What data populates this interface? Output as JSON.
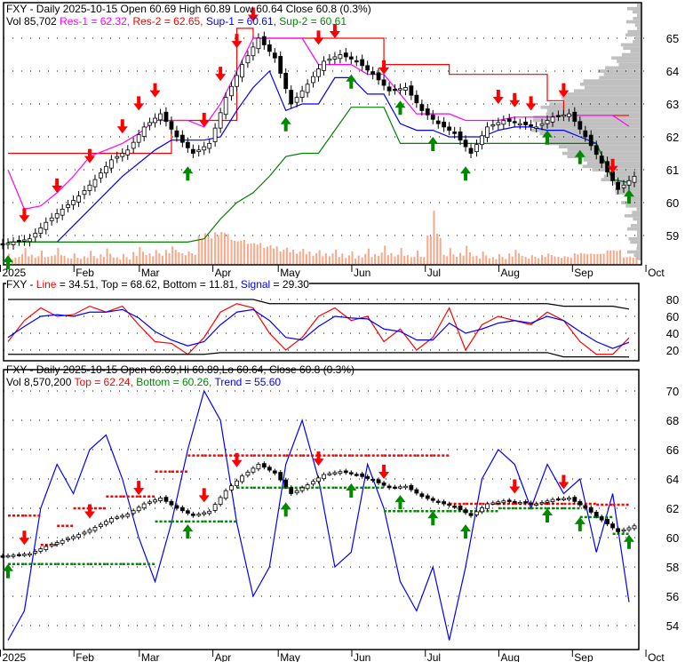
{
  "panel1": {
    "line1": "FXY - Daily 2025-10-15 Open 60.69  High 60.89  Low 60.64  Close 60.8 (0.3%)",
    "vol": "Vol 85,702",
    "res1": "Res-1 = 62.32,",
    "res2": "Res-2 = 62.65,",
    "sup1": "Sup-1 = 60.61,",
    "sup2": "Sup-2 = 60.61"
  },
  "panel2": {
    "prefix": "FXY - ",
    "line": "Line",
    "mid": " = 34.51, Top = 68.62, Bottom = 11.81, ",
    "signal": "Signal",
    "end": " = 29.30"
  },
  "panel3": {
    "line1": "FXY - Daily 2025-10-15 Open 60.69,Hi 60.89,Lo 60.64, Close 60.8 (0.3%)",
    "vol": "Vol 8,570,200",
    "top": "Top = 62.24,",
    "bottom": "Bottom = 60.26,",
    "trend": "Trend = 55.60"
  },
  "colors": {
    "res1": "#ff00ff",
    "res2": "#ff0000",
    "sup1": "#0000ff",
    "sup2": "#008000",
    "volume": "#f8a888",
    "profile": "#c0c0c0"
  },
  "chart_data": [
    {
      "type": "candlestick",
      "title": "FXY - Daily",
      "x_labels": [
        "2025",
        "Feb",
        "Mar",
        "Apr",
        "May",
        "Jun",
        "Jul",
        "Aug",
        "Sep",
        "Oct"
      ],
      "x_label_index": [
        0,
        4.5,
        8.5,
        13,
        17,
        21.5,
        26,
        30.5,
        35,
        39.5
      ],
      "y_ticks": [
        59,
        60,
        61,
        62,
        63,
        64,
        65
      ],
      "ylim": [
        58.2,
        66
      ],
      "close": [
        58.8,
        58.9,
        59.4,
        59.8,
        60.2,
        60.7,
        61.3,
        61.6,
        62.3,
        62.7,
        62.0,
        61.5,
        61.8,
        63.2,
        64.2,
        65.0,
        64.4,
        63.0,
        63.6,
        64.3,
        64.5,
        64.3,
        63.9,
        63.4,
        63.5,
        62.8,
        62.4,
        62.1,
        61.5,
        62.3,
        62.5,
        62.4,
        62.3,
        62.6,
        62.7,
        62.0,
        61.2,
        60.4,
        60.8
      ],
      "volume_rel": [
        0.2,
        0.3,
        0.25,
        0.3,
        0.2,
        0.25,
        0.3,
        0.2,
        0.35,
        0.3,
        0.4,
        0.3,
        0.8,
        0.9,
        0.7,
        0.6,
        0.5,
        0.4,
        0.35,
        0.3,
        0.3,
        0.25,
        0.3,
        0.35,
        0.3,
        0.25,
        1.0,
        0.3,
        0.35,
        0.25,
        0.2,
        0.3,
        0.2,
        0.25,
        0.2,
        0.3,
        0.3,
        0.4,
        0.2
      ],
      "res2": [
        61.5,
        61.5,
        61.5,
        61.5,
        61.5,
        61.5,
        61.5,
        61.5,
        61.5,
        61.5,
        62.5,
        62.5,
        62.5,
        62.5,
        65.3,
        65.0,
        65.0,
        65.0,
        65.0,
        65.0,
        65.0,
        65.0,
        65.0,
        64.2,
        64.2,
        64.2,
        64.2,
        63.9,
        63.9,
        63.9,
        63.9,
        63.9,
        63.9,
        63.1,
        62.65,
        62.65,
        62.65,
        62.65,
        62.65
      ],
      "res1": [
        61.0,
        59.8,
        59.9,
        60.3,
        60.8,
        61.4,
        61.6,
        61.8,
        62.1,
        62.5,
        62.5,
        62.5,
        62.3,
        63.0,
        64.0,
        65.0,
        65.0,
        65.0,
        65.0,
        64.2,
        64.2,
        64.2,
        63.9,
        63.9,
        63.3,
        62.7,
        62.7,
        62.7,
        62.5,
        62.5,
        62.5,
        62.6,
        62.6,
        62.6,
        62.65,
        62.65,
        62.65,
        62.65,
        62.32
      ],
      "sup1": [
        58.8,
        58.8,
        58.8,
        58.8,
        59.3,
        59.8,
        60.3,
        60.8,
        61.2,
        61.6,
        61.9,
        61.9,
        61.9,
        62.0,
        62.8,
        63.5,
        64.0,
        62.8,
        63.0,
        63.0,
        63.8,
        63.8,
        63.3,
        63.3,
        62.4,
        62.2,
        62.2,
        62.0,
        62.0,
        62.0,
        62.2,
        62.3,
        62.3,
        62.2,
        62.2,
        62.0,
        61.8,
        60.7,
        60.61
      ],
      "sup2": [
        58.8,
        58.8,
        58.8,
        58.8,
        58.8,
        58.8,
        58.8,
        58.8,
        58.8,
        58.8,
        58.8,
        58.8,
        58.9,
        59.5,
        60.0,
        60.3,
        60.8,
        61.4,
        61.5,
        61.5,
        62.2,
        62.9,
        62.9,
        62.9,
        61.8,
        61.8,
        61.8,
        61.8,
        61.8,
        61.8,
        61.8,
        61.8,
        61.8,
        61.8,
        61.8,
        61.8,
        61.8,
        60.7,
        60.61
      ],
      "sell_signals": [
        1,
        3,
        5,
        7,
        8,
        9,
        12,
        13,
        14,
        15,
        19,
        20,
        23,
        30,
        31,
        32,
        34,
        37
      ],
      "buy_signals": [
        0,
        11,
        17,
        21,
        24,
        26,
        28,
        33,
        35,
        38
      ]
    },
    {
      "type": "line",
      "title": "Oscillator",
      "y_ticks": [
        20,
        40,
        60,
        80
      ],
      "ylim": [
        5,
        95
      ],
      "series": [
        {
          "name": "Line",
          "color": "#ff0000",
          "values": [
            30,
            55,
            70,
            60,
            62,
            72,
            65,
            72,
            50,
            30,
            28,
            15,
            35,
            65,
            75,
            70,
            40,
            20,
            35,
            60,
            70,
            55,
            60,
            30,
            45,
            20,
            35,
            70,
            20,
            50,
            60,
            55,
            50,
            65,
            55,
            30,
            15,
            15,
            34.51
          ]
        },
        {
          "name": "Signal",
          "color": "#0000ff",
          "values": [
            35,
            48,
            60,
            62,
            60,
            65,
            65,
            68,
            58,
            42,
            32,
            25,
            30,
            50,
            65,
            68,
            55,
            35,
            32,
            48,
            60,
            58,
            57,
            45,
            42,
            32,
            32,
            52,
            40,
            45,
            52,
            55,
            52,
            60,
            55,
            42,
            30,
            22,
            29.3
          ]
        },
        {
          "name": "Top",
          "color": "#000000",
          "values": [
            80,
            80,
            80,
            80,
            80,
            80,
            80,
            80,
            80,
            80,
            80,
            80,
            80,
            80,
            80,
            80,
            75,
            75,
            75,
            75,
            75,
            75,
            75,
            75,
            75,
            75,
            75,
            75,
            75,
            75,
            75,
            75,
            75,
            75,
            72,
            72,
            72,
            72,
            68.62
          ]
        },
        {
          "name": "Bottom",
          "color": "#000000",
          "values": [
            15,
            15,
            15,
            15,
            15,
            15,
            15,
            15,
            15,
            15,
            15,
            15,
            15,
            17,
            17,
            17,
            17,
            17,
            17,
            17,
            17,
            17,
            17,
            17,
            17,
            17,
            17,
            17,
            17,
            17,
            17,
            17,
            17,
            17,
            12,
            12,
            12,
            12,
            11.81
          ]
        }
      ]
    },
    {
      "type": "candlestick",
      "title": "FXY - Daily (trend)",
      "y_ticks": [
        54,
        56,
        58,
        60,
        62,
        64,
        66,
        68,
        70
      ],
      "ylim": [
        52.5,
        71.5
      ],
      "trend": [
        53,
        55,
        62,
        65,
        63,
        66,
        67,
        64,
        60,
        57,
        61,
        66,
        70,
        68,
        61,
        56,
        58,
        65,
        68,
        64,
        58,
        59,
        65,
        62,
        57,
        55,
        58,
        53,
        58,
        64,
        66,
        65,
        62,
        65,
        63,
        64,
        59,
        63,
        55.6
      ],
      "top": [
        61.5,
        61.5,
        59.5,
        60.8,
        62.0,
        62.0,
        62.8,
        62.8,
        62.8,
        64.5,
        64.5,
        65.6,
        65.6,
        65.6,
        65.6,
        65.6,
        65.6,
        65.6,
        65.6,
        65.6,
        65.6,
        65.6,
        65.6,
        65.6,
        65.6,
        65.6,
        65.6,
        62.3,
        62.3,
        62.3,
        62.3,
        62.3,
        62.3,
        62.3,
        62.3,
        62.3,
        62.24,
        62.24,
        62.24
      ],
      "bottom": [
        58.2,
        58.2,
        58.2,
        58.2,
        58.2,
        58.2,
        58.2,
        58.2,
        58.2,
        61.1,
        61.1,
        61.1,
        61.1,
        61.1,
        63.4,
        63.4,
        63.4,
        63.4,
        63.4,
        63.4,
        63.4,
        63.4,
        63.4,
        61.8,
        61.8,
        61.8,
        61.8,
        61.8,
        61.8,
        61.8,
        62.0,
        62.0,
        62.0,
        62.0,
        62.0,
        61.4,
        61.4,
        60.26,
        60.26
      ]
    }
  ]
}
